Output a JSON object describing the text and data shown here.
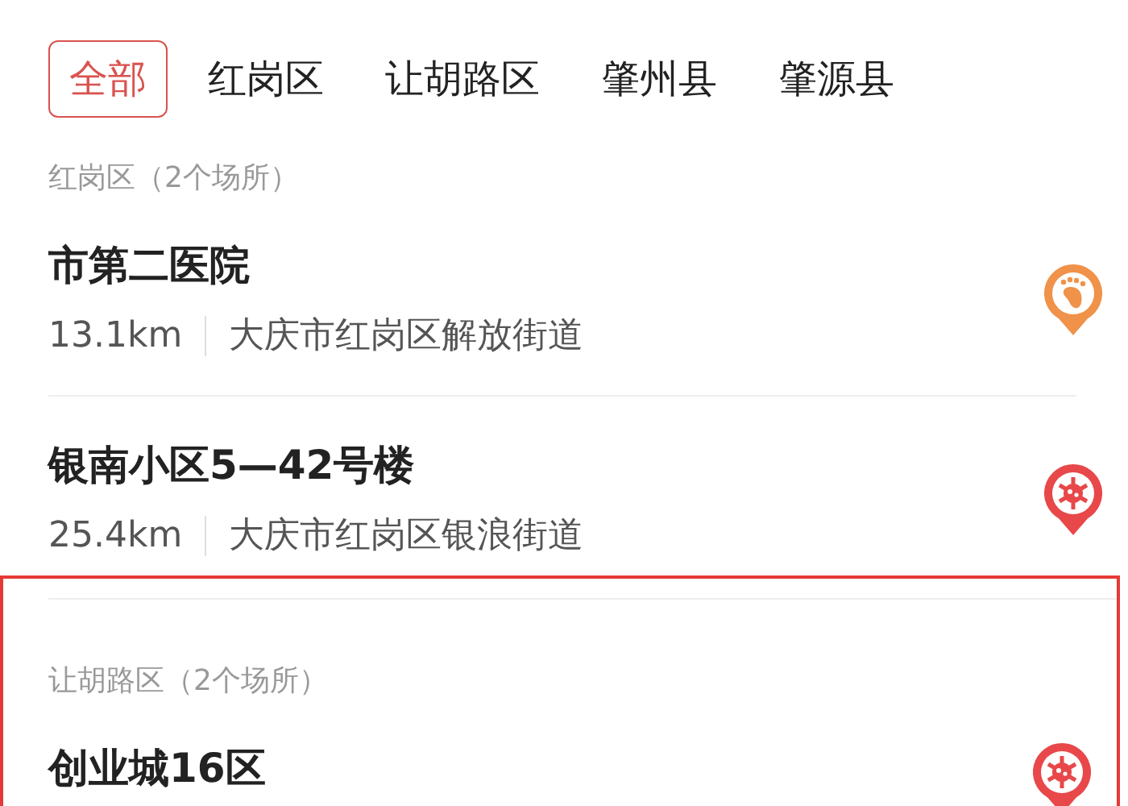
{
  "tabs": [
    {
      "label": "全部",
      "selected": true
    },
    {
      "label": "红岗区",
      "selected": false
    },
    {
      "label": "让胡路区",
      "selected": false
    },
    {
      "label": "肇州县",
      "selected": false
    },
    {
      "label": "肇源县",
      "selected": false
    }
  ],
  "groups": [
    {
      "heading": "红岗区（2个场所）",
      "highlighted": false,
      "places": [
        {
          "name": "市第二医院",
          "distance": "13.1km",
          "address": "大庆市红岗区解放街道",
          "kind": "footprint"
        },
        {
          "name": "银南小区5—42号楼",
          "distance": "25.4km",
          "address": "大庆市红岗区银浪街道",
          "kind": "virus"
        }
      ]
    },
    {
      "heading": "让胡路区（2个场所）",
      "highlighted": true,
      "places": [
        {
          "name": "创业城16区",
          "kind": "virus"
        }
      ]
    }
  ]
}
